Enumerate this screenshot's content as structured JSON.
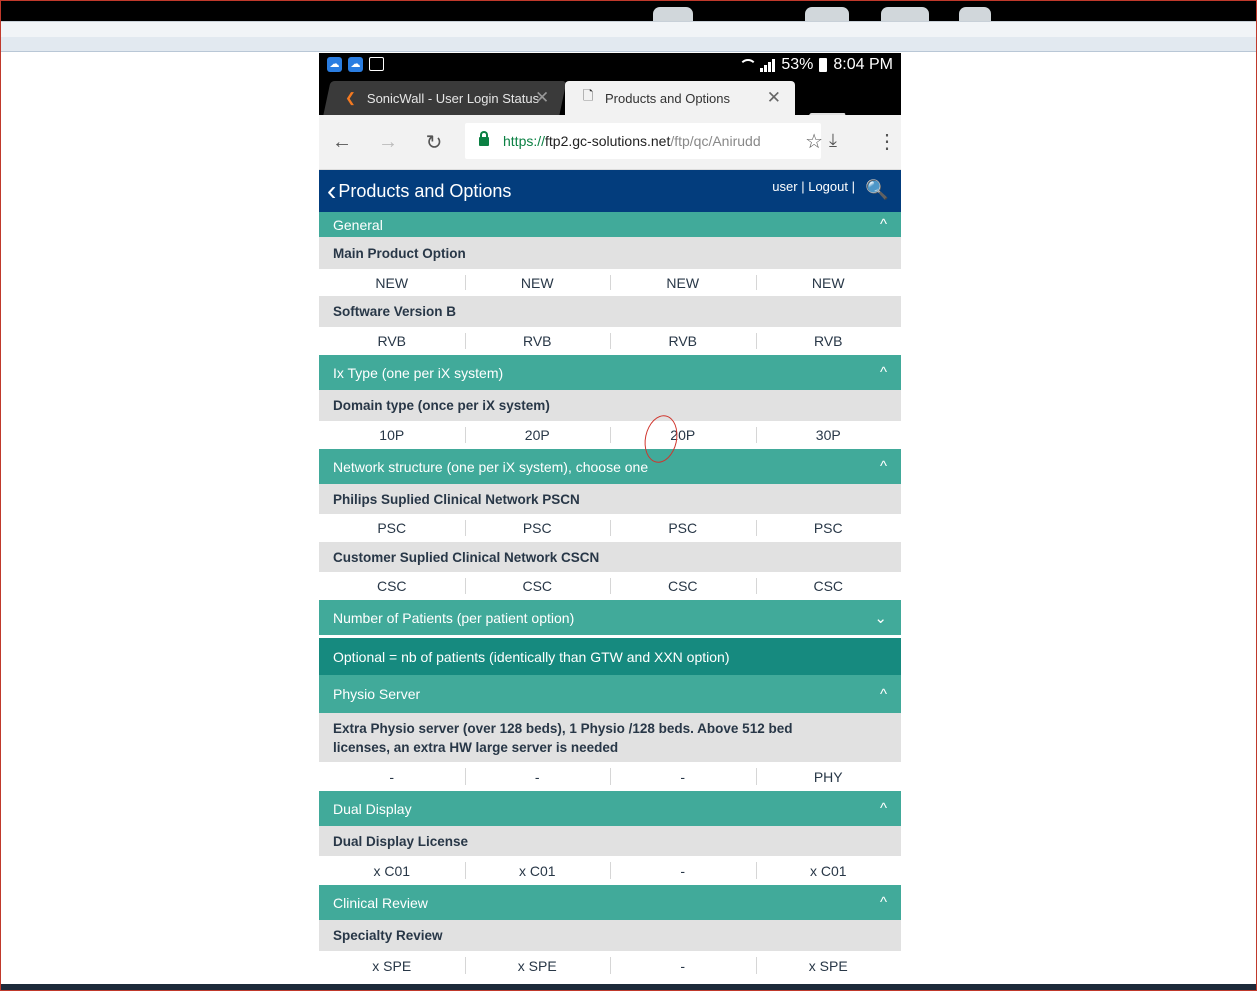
{
  "status": {
    "battery": "53%",
    "time": "8:04 PM"
  },
  "browser": {
    "tabs": [
      {
        "title": "SonicWall - User Login Status",
        "active": false
      },
      {
        "title": "Products and Options",
        "active": true
      }
    ],
    "url": {
      "scheme": "https://",
      "host": "ftp2.gc-solutions.net",
      "path": "/ftp/qc/Anirudd"
    }
  },
  "app": {
    "title": "Products and Options",
    "user": "user",
    "separator": "|",
    "logout": "Logout"
  },
  "sections": [
    {
      "title": "General",
      "rows": [
        {
          "option": "Main Product Option",
          "values": [
            "NEW",
            "NEW",
            "NEW",
            "NEW"
          ]
        },
        {
          "option": "Software Version B",
          "values": [
            "RVB",
            "RVB",
            "RVB",
            "RVB"
          ]
        }
      ]
    },
    {
      "title": "Ix Type (one per iX system)",
      "rows": [
        {
          "option": "Domain type (once per iX system)",
          "values": [
            "10P",
            "20P",
            "20P",
            "30P"
          ]
        }
      ]
    },
    {
      "title": "Network structure (one per iX system), choose one",
      "rows": [
        {
          "option": "Philips Suplied Clinical Network PSCN",
          "values": [
            "PSC",
            "PSC",
            "PSC",
            "PSC"
          ]
        },
        {
          "option": "Customer Suplied Clinical Network CSCN",
          "values": [
            "CSC",
            "CSC",
            "CSC",
            "CSC"
          ]
        }
      ]
    },
    {
      "title": "Number of Patients (per patient option)",
      "subtitle": "Optional = nb of patients (identically than GTW and XXN option)"
    },
    {
      "title": "Physio Server",
      "rows": [
        {
          "option": "Extra Physio server (over 128 beds), 1 Physio /128 beds. Above 512 bed licenses, an extra HW large server is needed",
          "values": [
            "-",
            "-",
            "-",
            "PHY"
          ]
        }
      ]
    },
    {
      "title": "Dual Display",
      "rows": [
        {
          "option": "Dual Display License",
          "values": [
            "x C01",
            "x C01",
            "-",
            "x C01"
          ]
        }
      ]
    },
    {
      "title": "Clinical Review",
      "rows": [
        {
          "option": "Specialty Review",
          "values": [
            "x SPE",
            "x SPE",
            "-",
            "x SPE"
          ]
        }
      ]
    }
  ]
}
